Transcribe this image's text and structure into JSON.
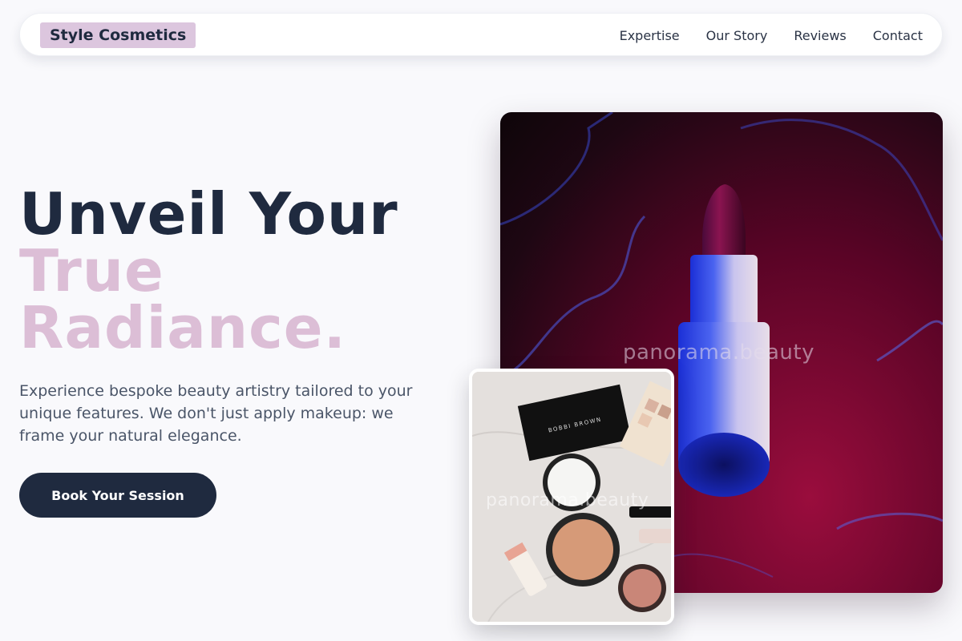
{
  "header": {
    "brand": "Style Cosmetics",
    "nav": [
      "Expertise",
      "Our Story",
      "Reviews",
      "Contact"
    ]
  },
  "hero": {
    "title_line1": "Unveil Your",
    "title_line2": "True",
    "title_line3": "Radiance.",
    "description": "Experience bespoke beauty artistry tailored to your unique features. We don't just apply makeup: we frame your natural elegance.",
    "cta_label": "Book Your Session"
  },
  "images": {
    "main_watermark": "panorama.beauty",
    "inset_watermark": "panorama.beauty",
    "compact_brand": "BOBBI BROWN"
  },
  "colors": {
    "primary_dark": "#1f2a3f",
    "accent_mauve": "#dcbed6",
    "brand_badge": "#dcc6de",
    "background": "#f9f9fc"
  }
}
